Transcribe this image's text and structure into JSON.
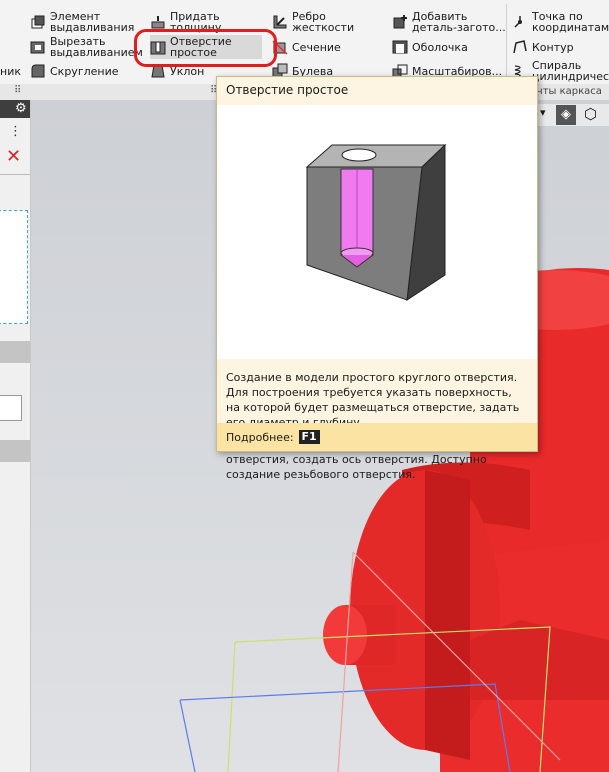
{
  "ribbon": {
    "items": [
      {
        "key": "extrude",
        "label": "Элемент\nвыдавливания",
        "icon": "extrude-icon"
      },
      {
        "key": "cut",
        "label": "Вырезать\nвыдавливанием",
        "icon": "cut-extrude-icon"
      },
      {
        "key": "fillet",
        "label": "Скругление",
        "icon": "fillet-icon"
      },
      {
        "key": "thickness",
        "label": "Придать\nтолщину",
        "icon": "thickness-icon"
      },
      {
        "key": "hole",
        "label": "Отверстие\nпростое",
        "icon": "hole-icon"
      },
      {
        "key": "draft",
        "label": "Уклон",
        "icon": "draft-icon"
      },
      {
        "key": "rib",
        "label": "Ребро\nжесткости",
        "icon": "rib-icon"
      },
      {
        "key": "section",
        "label": "Сечение",
        "icon": "section-icon"
      },
      {
        "key": "boolean",
        "label": "Булева",
        "icon": "boolean-icon"
      },
      {
        "key": "add-blank",
        "label": "Добавить\nдеталь-загото...",
        "icon": "add-blank-icon"
      },
      {
        "key": "shell",
        "label": "Оболочка",
        "icon": "shell-icon"
      },
      {
        "key": "scale",
        "label": "Масштабиров...",
        "icon": "scale-icon"
      },
      {
        "key": "point-coords",
        "label": "Точка по\nкоординатам",
        "icon": "point-icon"
      },
      {
        "key": "contour",
        "label": "Контур",
        "icon": "contour-icon"
      },
      {
        "key": "spiral",
        "label": "Спираль\nцилиндрическ...",
        "icon": "spiral-icon"
      }
    ],
    "left_cut_label": "ник",
    "group_label": "енты каркаса"
  },
  "tooltip": {
    "title": "Отверстие простое",
    "desc1": "Создание в модели простого круглого отверстия. Для построения требуется указать поверхность, на которой будет размещаться отверстие, задать его диаметр и глубину.",
    "desc2": "При построении можно задать форму торца отверстия, создать ось отверстия. Доступно создание резьбового отверстия.",
    "more_label": "Подробнее:",
    "hotkey": "F1"
  },
  "colors": {
    "model_red": "#f02d2d",
    "highlight": "#e21d1d",
    "tooltip_bg": "#fdf5e2",
    "tooltip_footer": "#fbe3a3"
  }
}
